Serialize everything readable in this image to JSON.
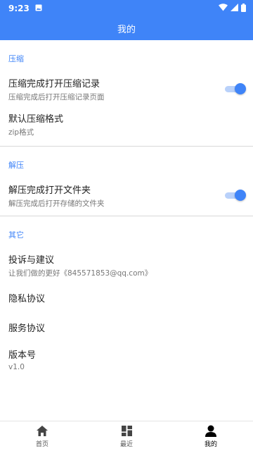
{
  "status_bar": {
    "time": "9:23"
  },
  "app_bar": {
    "title": "我的"
  },
  "sections": {
    "compress": {
      "header": "压缩",
      "open_after": {
        "title": "压缩完成打开压缩记录",
        "subtitle": "压缩完成后打开压缩记录页面",
        "enabled": true
      },
      "default_format": {
        "title": "默认压缩格式",
        "value": "zip格式"
      }
    },
    "extract": {
      "header": "解压",
      "open_after": {
        "title": "解压完成打开文件夹",
        "subtitle": "解压完成后打开存储的文件夹",
        "enabled": true
      }
    },
    "other": {
      "header": "其它",
      "feedback": {
        "title": "投诉与建议",
        "subtitle": "让我们做的更好《845571853@qq.com》"
      },
      "privacy": {
        "title": "隐私协议"
      },
      "service": {
        "title": "服务协议"
      },
      "version": {
        "title": "版本号",
        "value": "v1.0"
      }
    }
  },
  "bottom_nav": {
    "tabs": [
      {
        "label": "首页",
        "icon": "home-icon",
        "active": false
      },
      {
        "label": "最近",
        "icon": "dashboard-icon",
        "active": false
      },
      {
        "label": "我的",
        "icon": "person-icon",
        "active": true
      }
    ]
  },
  "colors": {
    "primary": "#3f84f8",
    "toggle_track": "#b9d1fa"
  }
}
